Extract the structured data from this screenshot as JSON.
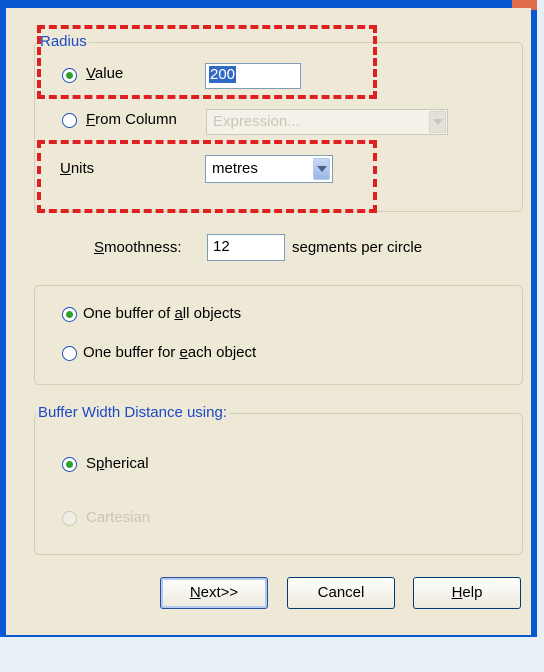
{
  "radius_group": {
    "caption": "Radius",
    "value_option": {
      "label": "Value",
      "selected": true
    },
    "value_input": "200",
    "column_option": {
      "label": "From Column",
      "selected": false
    },
    "column_placeholder": "Expression..."
  },
  "units": {
    "label": "Units",
    "selected": "metres"
  },
  "smoothness": {
    "label": "Smoothness:",
    "value": "12",
    "suffix": "segments per circle"
  },
  "buffer_mode": {
    "one_all": {
      "label": "One buffer of all objects",
      "selected": true
    },
    "one_each": {
      "label": "One buffer for each object",
      "selected": false
    }
  },
  "width_group": {
    "caption": "Buffer Width Distance using:",
    "spherical": {
      "label": "Spherical",
      "selected": true
    },
    "cartesian": {
      "label": "Cartesian",
      "selected": false,
      "disabled": true
    }
  },
  "buttons": {
    "next": "Next>>",
    "cancel": "Cancel",
    "help": "Help"
  },
  "colors": {
    "highlight_dash": "#e02020",
    "frame": "#0a57d2",
    "dialog": "#ede9d6"
  }
}
